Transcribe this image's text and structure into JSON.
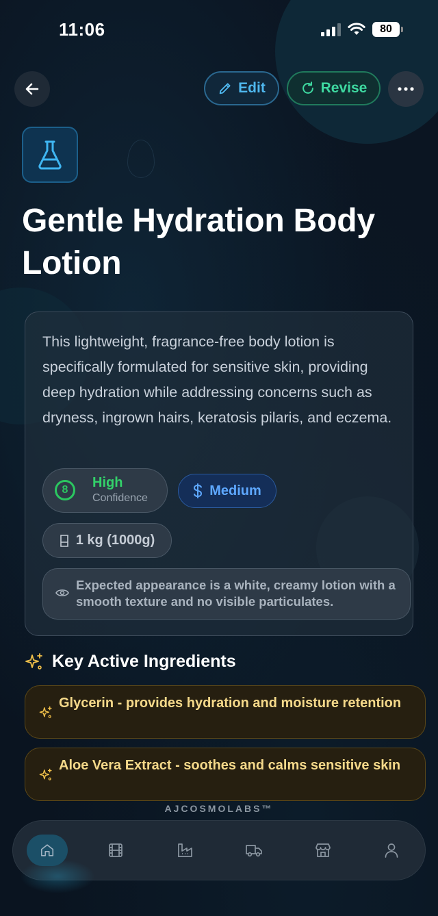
{
  "status_bar": {
    "time": "11:06",
    "battery": "80"
  },
  "header": {
    "edit_label": "Edit",
    "revise_label": "Revise"
  },
  "product": {
    "title": "Gentle Hydration Body Lotion",
    "description": "This lightweight, fragrance-free body lotion is specifically formulated for sensitive skin, providing deep hydration while addressing concerns such as dryness, ingrown hairs, keratosis pilaris, and eczema.",
    "confidence": {
      "score": "8",
      "level": "High",
      "label": "Confidence"
    },
    "cost": "Medium",
    "batch_size": "1 kg (1000g)",
    "appearance": "Expected appearance is a white, creamy lotion with a smooth texture and no visible particulates."
  },
  "ingredients_section": {
    "title": "Key Active Ingredients",
    "items": [
      "Glycerin - provides hydration and moisture retention",
      "Aloe Vera Extract - soothes and calms sensitive skin"
    ]
  },
  "brand": "AJCOSMOLABS™",
  "nav": {
    "items": [
      "home-icon",
      "film-icon",
      "factory-icon",
      "truck-icon",
      "store-icon",
      "user-icon"
    ],
    "active": "home-icon"
  },
  "colors": {
    "edit_accent": "#4fb8ef",
    "revise_accent": "#3ed8a0",
    "confidence_green": "#2bc760",
    "cost_blue": "#5ea8ff",
    "ingredient_gold": "#f5d98a"
  }
}
